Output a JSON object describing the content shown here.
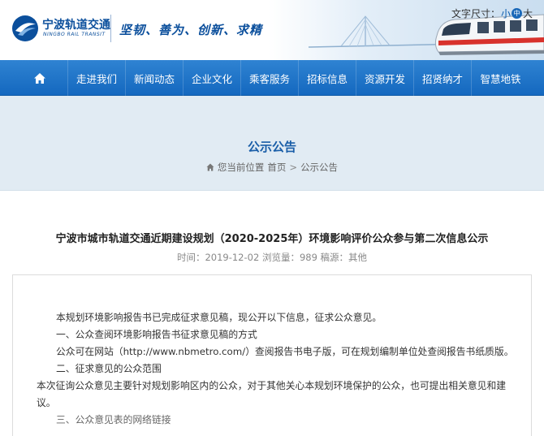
{
  "header": {
    "logo_cn": "宁波轨道交通",
    "logo_en": "NINGBO RAIL TRANSIT",
    "slogan": "坚韧、善为、创新、求精",
    "font_size_label": "文字尺寸：",
    "font_small": "小",
    "font_mid": "中",
    "font_large": "大"
  },
  "nav": {
    "home_icon": "home-icon",
    "items": [
      "走进我们",
      "新闻动态",
      "企业文化",
      "乘客服务",
      "招标信息",
      "资源开发",
      "招贤纳才",
      "智慧地铁"
    ]
  },
  "banner": {
    "title": "公示公告",
    "crumb_prefix": "您当前位置",
    "crumb_home": "首页",
    "crumb_sep": ">",
    "crumb_current": "公示公告"
  },
  "article": {
    "title": "宁波市城市轨道交通近期建设规划（2020-2025年）环境影响评价公众参与第二次信息公示",
    "meta": "时间：2019-12-02 浏览量：989 稿源：其他",
    "paragraphs": [
      "本规划环境影响报告书已完成征求意见稿，现公开以下信息，征求公众意见。",
      "一、公众查阅环境影响报告书征求意见稿的方式",
      "公众可在网站（http://www.nbmetro.com/）查阅报告书电子版，可在规划编制单位处查阅报告书纸质版。",
      "二、征求意见的公众范围",
      "本次征询公众意见主要针对规划影响区内的公众，对于其他关心本规划环境保护的公众，也可提出相关意见和建议。",
      "三、公众意见表的网络链接"
    ]
  },
  "colors": {
    "nav_blue": "#1a6fc4",
    "banner_bg": "#e1ebf3",
    "title_blue": "#1a5ea8"
  }
}
